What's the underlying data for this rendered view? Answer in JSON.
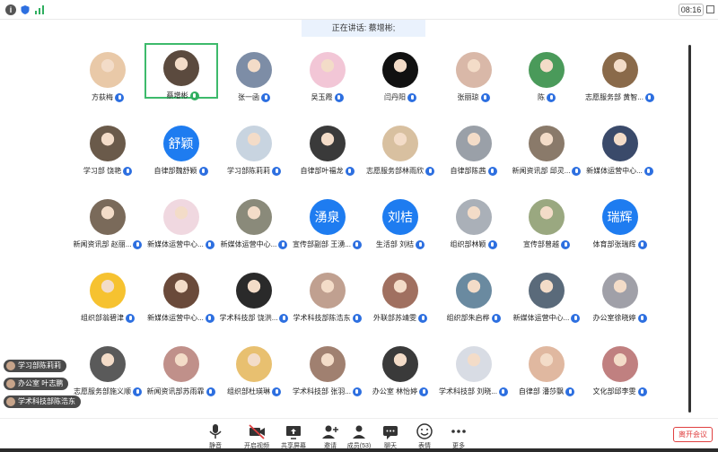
{
  "status_bar": {
    "time": "08:16"
  },
  "speaking": {
    "text": "正在讲话: 蔡增彬;"
  },
  "participants": [
    {
      "name": "方荻梅",
      "mic": "blue"
    },
    {
      "name": "蔡增彬",
      "mic": "green",
      "active": true
    },
    {
      "name": "张一函",
      "mic": "blue"
    },
    {
      "name": "吴玉霞",
      "mic": "blue"
    },
    {
      "name": "闫丹阳",
      "mic": "blue"
    },
    {
      "name": "张丽琼",
      "mic": "blue"
    },
    {
      "name": "陈",
      "mic": "blue"
    },
    {
      "name": "志愿服务部 黄智...",
      "mic": "blue"
    },
    {
      "name": "学习部 饶艳",
      "mic": "blue"
    },
    {
      "name": "自律部魏舒颖",
      "mic": "blue",
      "avatar_text": "舒颖"
    },
    {
      "name": "学习部陈莉莉",
      "mic": "blue"
    },
    {
      "name": "自律部叶福龙",
      "mic": "blue"
    },
    {
      "name": "志愿服务部林雨欣",
      "mic": "blue"
    },
    {
      "name": "自律部陈茜",
      "mic": "blue"
    },
    {
      "name": "新闻资讯部 邱灵...",
      "mic": "blue"
    },
    {
      "name": "新媒体运营中心...",
      "mic": "blue"
    },
    {
      "name": "新闻资讯部 赵丽...",
      "mic": "blue"
    },
    {
      "name": "新媒体运营中心...",
      "mic": "blue"
    },
    {
      "name": "新媒体运营中心...",
      "mic": "blue"
    },
    {
      "name": "宣传部副部 王湧...",
      "mic": "blue",
      "avatar_text": "湧泉"
    },
    {
      "name": "生活部 刘桔",
      "mic": "blue",
      "avatar_text": "刘桔"
    },
    {
      "name": "组织部林颖",
      "mic": "blue"
    },
    {
      "name": "宣传部曾越",
      "mic": "blue"
    },
    {
      "name": "体育部张瑞辉",
      "mic": "blue",
      "avatar_text": "瑞辉"
    },
    {
      "name": "组织部翁碧津",
      "mic": "blue"
    },
    {
      "name": "新媒体运营中心...",
      "mic": "blue"
    },
    {
      "name": "学术科技部 饶洪...",
      "mic": "blue"
    },
    {
      "name": "学术科技部陈浩东",
      "mic": "blue"
    },
    {
      "name": "外联部苏靖雯",
      "mic": "blue"
    },
    {
      "name": "组织部朱启桦",
      "mic": "blue"
    },
    {
      "name": "新媒体运营中心...",
      "mic": "blue"
    },
    {
      "name": "办公室徐晓婷",
      "mic": "blue"
    },
    {
      "name": "志愿服务部施义顺",
      "mic": "blue"
    },
    {
      "name": "新闻资讯部苏雨霏",
      "mic": "blue"
    },
    {
      "name": "组织部杜瑛琳",
      "mic": "blue"
    },
    {
      "name": "学术科技部 张羽...",
      "mic": "blue"
    },
    {
      "name": "办公室 林怡婷",
      "mic": "blue"
    },
    {
      "name": "学术科技部 刘晓...",
      "mic": "blue"
    },
    {
      "name": "自律部 潘莎飘",
      "mic": "blue"
    },
    {
      "name": "文化部邱李雯",
      "mic": "blue"
    }
  ],
  "chat_bubbles": [
    "学习部陈莉莉",
    "办公室 叶志鹏",
    "学术科技部陈浩东"
  ],
  "toolbar": [
    {
      "label": "静音",
      "icon": "mic-icon"
    },
    {
      "label": "开启视频",
      "icon": "video-off-icon"
    },
    {
      "label": "共享屏幕",
      "icon": "share-screen-icon"
    },
    {
      "label": "邀请",
      "icon": "invite-icon"
    },
    {
      "label": "成员(53)",
      "icon": "members-icon"
    },
    {
      "label": "聊天",
      "icon": "chat-icon"
    },
    {
      "label": "表情",
      "icon": "emoji-icon"
    },
    {
      "label": "更多",
      "icon": "more-icon"
    }
  ],
  "leave_label": "离开会议",
  "colors": {
    "mic_blue": "#2d6fe0",
    "mic_green": "#2fae5f",
    "text_avatar": "#1e7cf0",
    "active_border": "#3dba6b",
    "leave_red": "#e04040"
  }
}
